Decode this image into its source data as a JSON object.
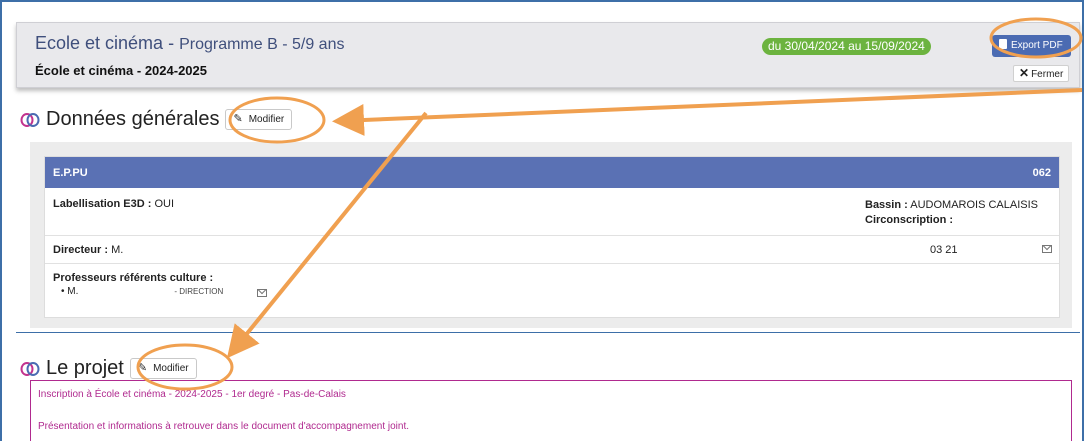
{
  "header": {
    "title": "Ecole et cinéma",
    "title_sep": " - ",
    "program": "Programme B - 5/9 ans",
    "subtitle": "École et cinéma - 2024-2025",
    "date_range": "du 30/04/2024  au 15/09/2024",
    "export_label": "Export PDF",
    "close_label": "Fermer"
  },
  "sections": {
    "general_title": "Données générales",
    "projet_title": "Le projet",
    "modify_label": "Modifier"
  },
  "etablissement": {
    "name": "E.P.PU",
    "code": "062",
    "labellisation_label": "Labellisation E3D :",
    "labellisation_value": "OUI",
    "bassin_label": "Bassin :",
    "bassin_value": "AUDOMAROIS CALAISIS",
    "circonscription_label": "Circonscription :",
    "directeur_label": "Directeur :",
    "directeur_value": "M.",
    "telephone": "03 21",
    "profs_label": "Professeurs référents culture :",
    "profs": [
      {
        "name": "M.",
        "role": "- DIRECTION"
      }
    ]
  },
  "projet": {
    "line1": "Inscription à École et cinéma - 2024-2025 - 1er degré - Pas-de-Calais",
    "line2": "Présentation et informations à retrouver dans le document d'accompagnement joint."
  },
  "colors": {
    "brand": "#3f4f7c",
    "card_head": "#5a71b4",
    "badge_green": "#6cb33f",
    "annotation_orange": "#f0a050",
    "projet_magenta": "#b02a8f"
  }
}
